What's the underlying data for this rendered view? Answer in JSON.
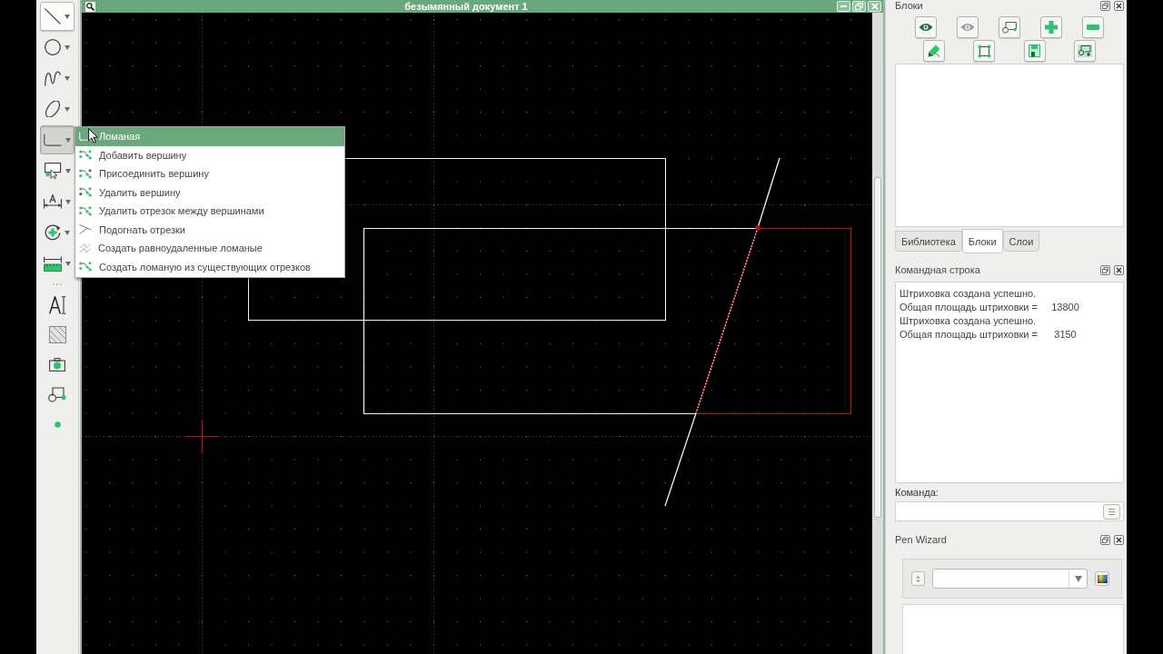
{
  "toolbar": [
    {
      "highlighted": true,
      "selected": false,
      "dropdown": true
    },
    {
      "highlighted": false,
      "selected": false,
      "dropdown": true
    },
    {
      "highlighted": false,
      "selected": false,
      "dropdown": true
    },
    {
      "highlighted": false,
      "selected": false,
      "dropdown": true
    },
    {
      "highlighted": false,
      "selected": true,
      "dropdown": true
    },
    {
      "highlighted": false,
      "selected": false,
      "dropdown": true
    },
    {
      "highlighted": false,
      "selected": false,
      "dropdown": true
    },
    {
      "highlighted": false,
      "selected": false,
      "dropdown": true
    },
    {
      "highlighted": false,
      "selected": false,
      "dropdown": true
    },
    {
      "highlighted": false,
      "selected": false,
      "dropdown": false
    },
    {
      "highlighted": false,
      "selected": false,
      "dropdown": false
    },
    {
      "highlighted": false,
      "selected": false,
      "dropdown": false
    },
    {
      "highlighted": false,
      "selected": false,
      "dropdown": false
    },
    {
      "highlighted": false,
      "selected": false,
      "dropdown": false
    }
  ],
  "tool_menu": {
    "items": [
      {
        "label": "Ломаная",
        "selected": true
      },
      {
        "label": "Добавить вершину",
        "selected": false
      },
      {
        "label": "Присоединить вершину",
        "selected": false
      },
      {
        "label": "Удалить вершину",
        "selected": false
      },
      {
        "label": "Удалить отрезок между вершинами",
        "selected": false
      },
      {
        "label": "Подогнать отрезки",
        "selected": false
      },
      {
        "label": "Создать равноудаленные ломаные",
        "selected": false
      },
      {
        "label": "Создать ломаную из существующих отрезков",
        "selected": false
      }
    ]
  },
  "document_window": {
    "title": "безымянный документ 1"
  },
  "blocks_dock": {
    "title": "Блоки"
  },
  "dock_tabs": [
    {
      "label": "Библиотека",
      "selected": false
    },
    {
      "label": "Блоки",
      "selected": true
    },
    {
      "label": "Слои",
      "selected": false
    }
  ],
  "command_dock": {
    "title": "Командная строка",
    "output": [
      "Штриховка создана успешно.",
      "Общая площадь штриховки =     13800",
      "Штриховка создана успешно.",
      "Общая площадь штриховки =      3150"
    ],
    "input_label": "Команда:"
  },
  "pen_wizard_dock": {
    "title": "Pen Wizard"
  }
}
